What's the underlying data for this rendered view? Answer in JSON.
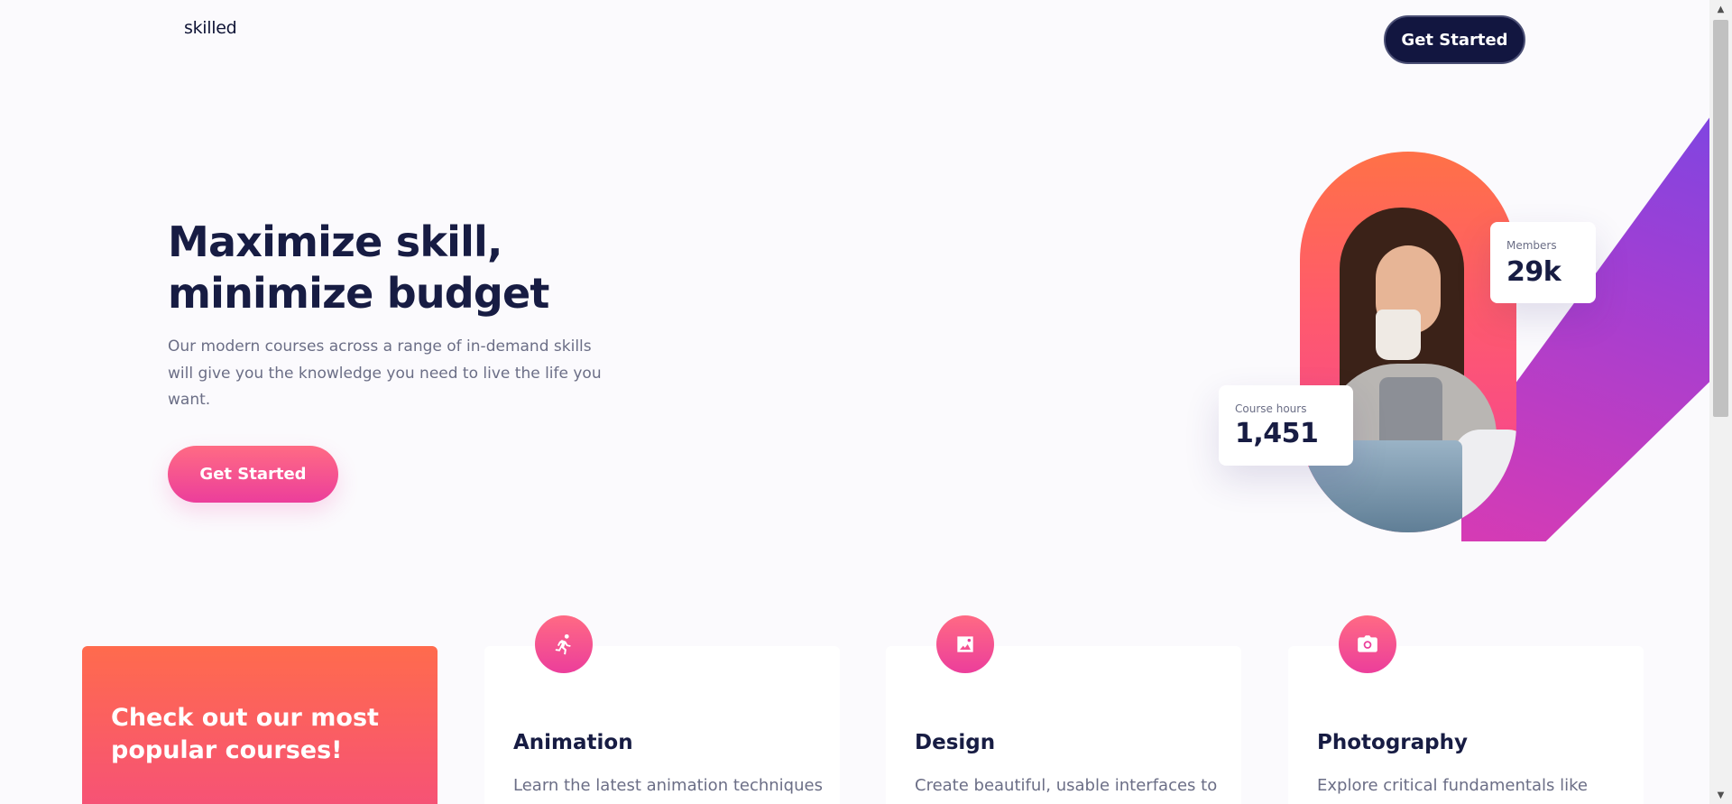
{
  "header": {
    "logo": "skilled",
    "cta_label": "Get Started"
  },
  "hero": {
    "title_line1": "Maximize skill,",
    "title_line2": "minimize budget",
    "description": "Our modern courses across a range of in-demand skills will give you the knowledge you need to live the life you want.",
    "cta_label": "Get Started",
    "image_alt": "Woman drinking from a mug while looking at a laptop"
  },
  "stats": {
    "members_label": "Members",
    "members_value": "29k",
    "hours_label": "Course hours",
    "hours_value": "1,451"
  },
  "courses": {
    "promo_title": "Check out our most popular courses!",
    "items": [
      {
        "title": "Animation",
        "description": "Learn the latest animation techniques",
        "icon": "running-person-icon"
      },
      {
        "title": "Design",
        "description": "Create beautiful, usable interfaces to",
        "icon": "design-icon"
      },
      {
        "title": "Photography",
        "description": "Explore critical fundamentals like",
        "icon": "camera-icon"
      }
    ]
  },
  "colors": {
    "navy": "#171c43",
    "pink": "#ec3e9b",
    "coral": "#ff6b4d",
    "purple": "#5a4bf0"
  }
}
